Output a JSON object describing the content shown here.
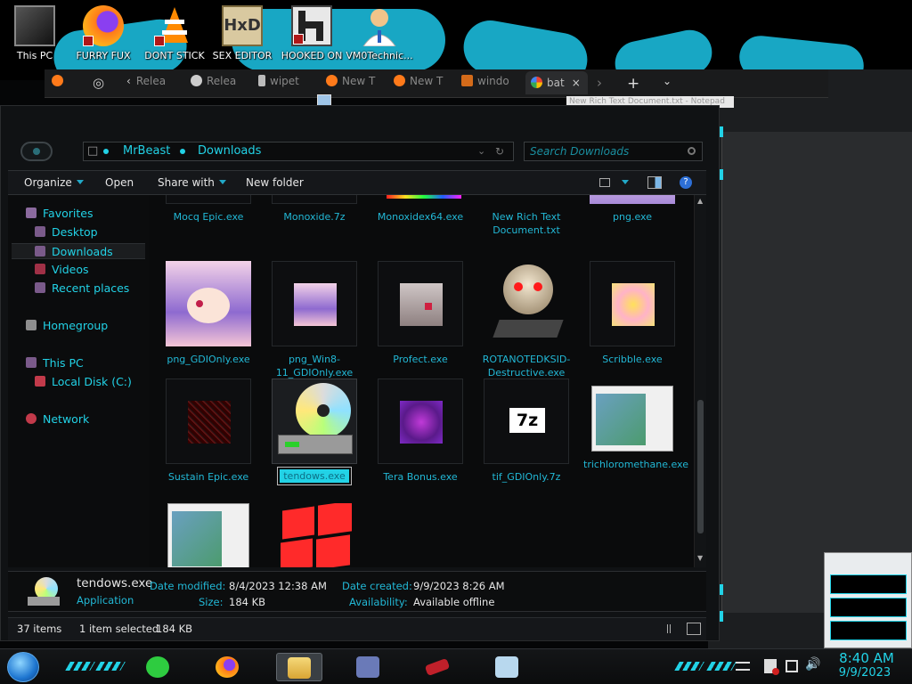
{
  "desktop": {
    "icons": [
      {
        "label": "This PC"
      },
      {
        "label": "FURRY FUX"
      },
      {
        "label": "DONT STICK"
      },
      {
        "label": "SEX EDITOR"
      },
      {
        "label": "HOOKED ON"
      },
      {
        "label": "VM0Technic..."
      }
    ]
  },
  "browser": {
    "tabs": [
      "Relea",
      "Relea",
      "wipet",
      "New T",
      "New T",
      "windo",
      "bat"
    ],
    "new_tab_symbol": "+",
    "tooltip": "New Rich Text Document.txt - Notepad"
  },
  "explorer": {
    "breadcrumb": [
      "MrBeast",
      "Downloads"
    ],
    "search_placeholder": "Search Downloads",
    "toolbar": {
      "organize": "Organize",
      "open": "Open",
      "share_with": "Share with",
      "new_folder": "New folder",
      "help": "?"
    },
    "nav": {
      "favorites": "Favorites",
      "desktop": "Desktop",
      "downloads": "Downloads",
      "videos": "Videos",
      "recent_places": "Recent places",
      "homegroup": "Homegroup",
      "this_pc": "This PC",
      "local_disk": "Local Disk (C:)",
      "network": "Network"
    },
    "files": [
      {
        "name": "Mocq Epic.exe",
        "icon": "anime-girl-thumbnail"
      },
      {
        "name": "Monoxide.7z",
        "icon": "archive-thumbnail"
      },
      {
        "name": "Monoxidex64.exe",
        "icon": "rainbow-thumbnail"
      },
      {
        "name": "New Rich Text Document.txt",
        "icon": "pencil-text-icon"
      },
      {
        "name": "png.exe",
        "icon": "anime-girl-thumbnail"
      },
      {
        "name": "png_GDIOnly.exe",
        "icon": "anime-girl-bunny-icon"
      },
      {
        "name": "png_Win8-11_GDIOnly.exe",
        "icon": "anime-girl-bunny-small-icon"
      },
      {
        "name": "Profect.exe",
        "icon": "pixel-girl-icon"
      },
      {
        "name": "ROTANOTEDKSID-Destructive.exe",
        "icon": "skull-icon"
      },
      {
        "name": "Scribble.exe",
        "icon": "swirl-icon"
      },
      {
        "name": "Sustain Epic.exe",
        "icon": "glitch-icon"
      },
      {
        "name": "tendows.exe",
        "icon": "disc-drive-icon"
      },
      {
        "name": "Tera Bonus.exe",
        "icon": "purple-noise-icon"
      },
      {
        "name": "tif_GDIOnly.7z",
        "icon": "7z-archive-icon"
      },
      {
        "name": "trichloromethane.exe",
        "icon": "window-preview-icon"
      },
      {
        "name": "",
        "icon": "window-preview-icon"
      },
      {
        "name": "",
        "icon": "windows-flag-icon"
      }
    ],
    "details": {
      "file_name": "tendows.exe",
      "file_type": "Application",
      "date_modified_label": "Date modified:",
      "date_modified": "8/4/2023 12:38 AM",
      "size_label": "Size:",
      "size": "184 KB",
      "date_created_label": "Date created:",
      "date_created": "9/9/2023 8:26 AM",
      "availability_label": "Availability:",
      "availability": "Available offline"
    },
    "status": {
      "items": "37 items",
      "selected": "1 item selected",
      "selected_size": "184 KB"
    }
  },
  "taskbar": {
    "time": "8:40 AM",
    "date": "9/9/2023"
  },
  "colors": {
    "accent": "#22d2e6",
    "link": "#22b8d6",
    "background": "#0a0b0c"
  }
}
